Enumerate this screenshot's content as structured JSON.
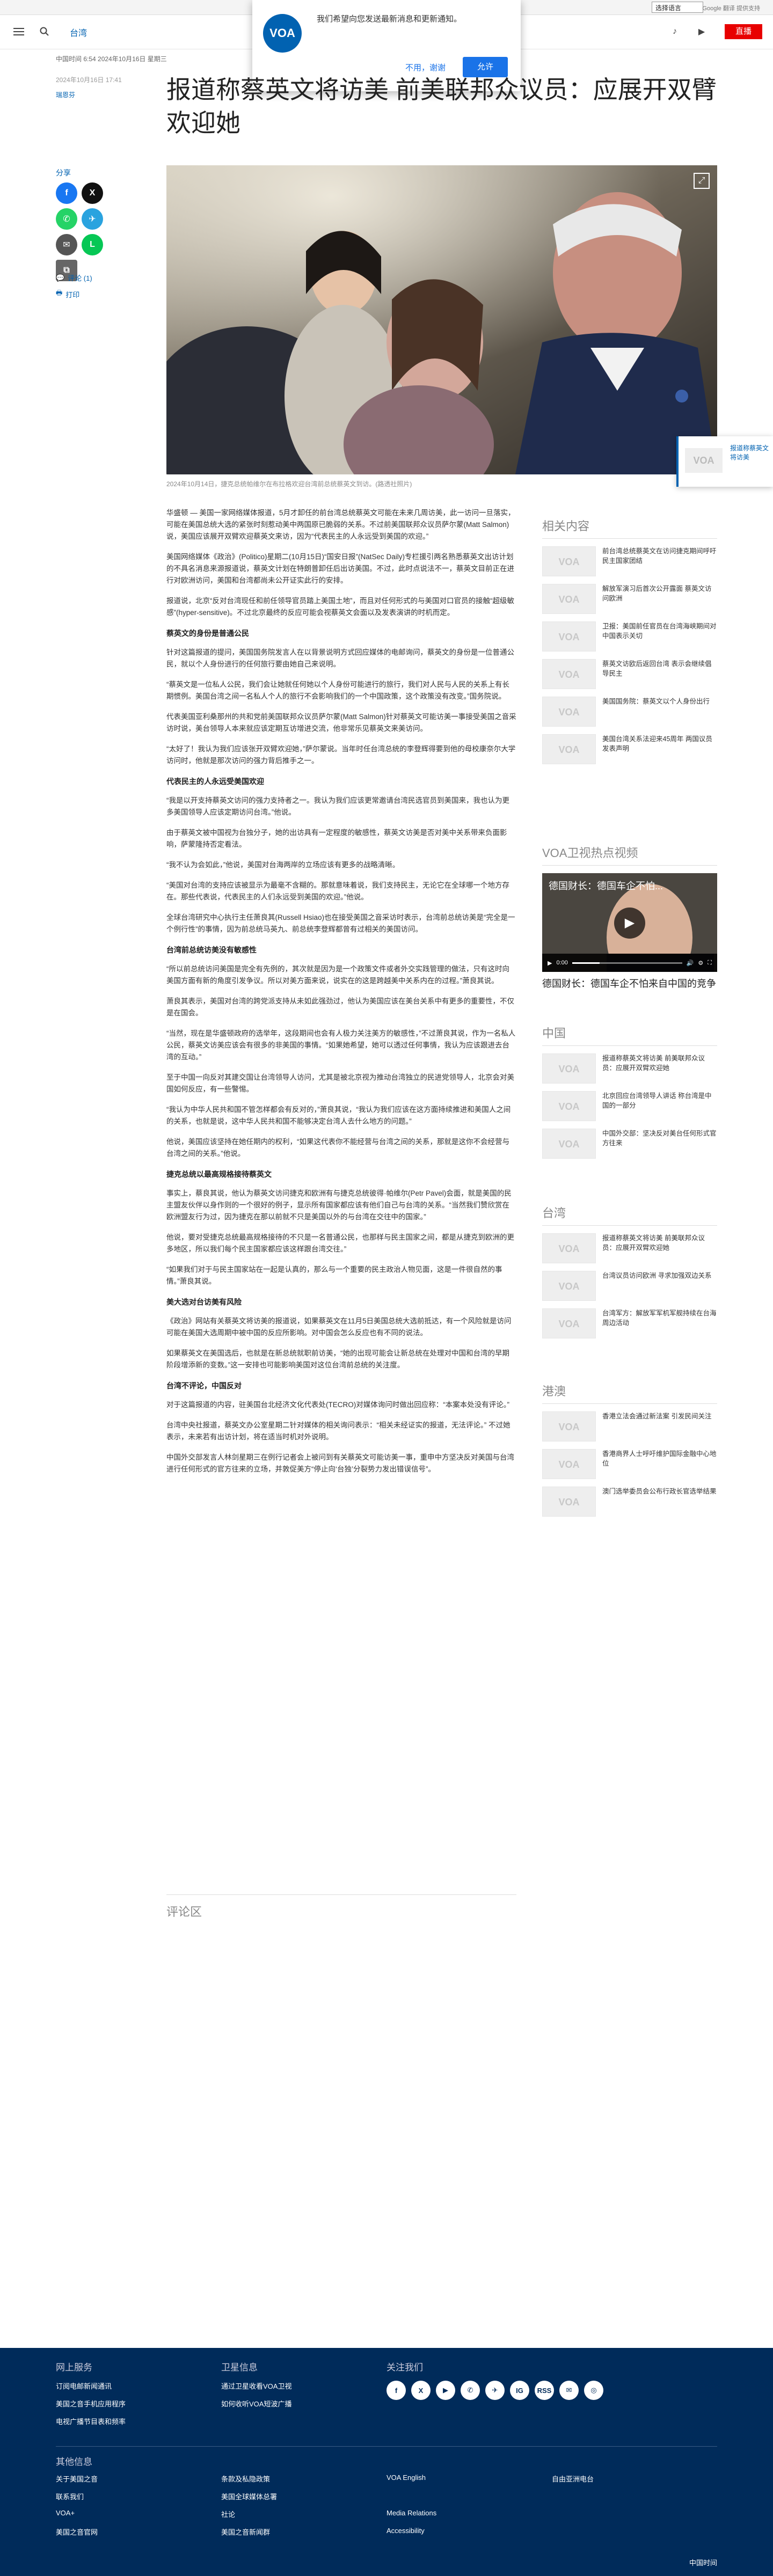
{
  "topbar": {
    "language_select": "选择语言",
    "translate_brand": "Google 翻译 提供支持"
  },
  "header": {
    "nav_link": "台湾",
    "live_label": "直播"
  },
  "popup": {
    "message": "我们希望向您发送最新消息和更新通知。",
    "logo_text": "VOA",
    "decline_label": "不用，谢谢",
    "accept_label": "允许"
  },
  "article": {
    "published": "中国时间 6:54 2024年10月16日 星期三",
    "updated": "2024年10月16日 17:41",
    "author": "瑞恩芬",
    "title": "报道称蔡英文将访美 前美联邦众议员：应展开双臂欢迎她",
    "share_label": "分享",
    "comments_link": "评论 (1)",
    "print_link": "打印",
    "image_caption": "2024年10月14日，捷克总统帕维尔在布拉格欢迎台湾前总统蔡英文到访。(路透社照片)",
    "comments_heading": "评论区"
  },
  "body": [
    {
      "type": "p",
      "text": "华盛顿 — 美国一家网络媒体报道，5月才卸任的前台湾总统蔡英文可能在未来几周访美，此一访问一旦落实，可能在美国总统大选的紧张时刻惹动美中两国原已脆弱的关系。不过前美国联邦众议员萨尔蒙(Matt Salmon)说，美国应该展开双臂欢迎蔡英文来访，因为“代表民主的人永远受到美国的欢迎。”"
    },
    {
      "type": "p",
      "text": "美国网络媒体《政治》(Politico)星期二(10月15日)“国安日报”(NatSec Daily)专栏援引两名熟悉蔡英文出访计划的不具名消息来源报道说，蔡英文计划在特朗普卸任后出访美国。不过，此时点说法不一，蔡英文目前正在进行对欧洲访问，美国和台湾都尚未公开证实此行的安排。"
    },
    {
      "type": "p",
      "text": "报道说，北京“反对台湾现任和前任领导官员踏上美国土地”，而且对任何形式的与美国对口官员的接触“超级敏感”(hyper-sensitive)。不过北京最终的反应可能会视蔡英文会面以及发表演讲的时机而定。"
    },
    {
      "type": "h",
      "text": "蔡英文的身份是普通公民"
    },
    {
      "type": "p",
      "text": "针对这篇报道的提问，美国国务院发言人在以背景说明方式回应媒体的电邮询问，蔡英文的身份是一位普通公民，就以个人身份进行的任何旅行要由她自己来说明。"
    },
    {
      "type": "p",
      "text": "“蔡英文是一位私人公民，我们会让她就任何她以个人身份可能进行的旅行，我们对人民与人民的关系上有长期惯例。美国台湾之间一名私人个人的旅行不会影响我们的一个中国政策，这个政策没有改变。”国务院说。"
    },
    {
      "type": "p",
      "text": "代表美国亚利桑那州的共和党前美国联邦众议员萨尔蒙(Matt Salmon)针对蔡英文可能访美一事接受美国之音采访时说，美台领导人本来就应该定期互访增进交流，他非常乐见蔡英文来美访问。"
    },
    {
      "type": "p",
      "text": "“太好了！我认为我们应该张开双臂欢迎她，”萨尔蒙说。当年时任台湾总统的李登辉得要到他的母校康奈尔大学访问时，他就是那次访问的强力背后推手之一。"
    },
    {
      "type": "h",
      "text": "代表民主的人永远受美国欢迎"
    },
    {
      "type": "p",
      "text": "“我是以开支持蔡英文访问的强力支持者之一。我认为我们应该更常邀请台湾民选官员到美国来，我也认为更多美国领导人应该定期访问台湾。”他说。"
    },
    {
      "type": "p",
      "text": "由于蔡英文被中国视为台独分子，她的出访具有一定程度的敏感性，蔡英文访美是否对美中关系带来负面影响，萨蒙隆持否定看法。"
    },
    {
      "type": "p",
      "text": "“我不认为会如此，”他说，美国对台海两岸的立场应该有更多的战略清晰。"
    },
    {
      "type": "p",
      "text": "“美国对台湾的支持应该被显示为最毫不含糊的。那就意味着说，我们支持民主，无论它在全球哪一个地方存在。那些代表说，代表民主的人们永远受到美国的欢迎。”他说。"
    },
    {
      "type": "p",
      "text": "全球台湾研究中心执行主任萧良其(Russell Hsiao)也在接受美国之音采访时表示，台湾前总统访美是“完全是一个例行性”的事情，因为前总统马英九、前总统李登辉都曾有过相关的美国访问。"
    },
    {
      "type": "h",
      "text": "台湾前总统访美没有敏感性"
    },
    {
      "type": "p",
      "text": "“所以前总统访问美国是完全有先例的，其次就是因为是一个政策文件或者外交实践管理的做法，只有这时向美国方面有新的角度引发争议。所以对美方面来说，说实在的这是跨越美中关系内在的过程。”萧良其说。"
    },
    {
      "type": "p",
      "text": "萧良其表示，美国对台湾的跨党派支持从未如此强劲过，他认为美国应该在美台关系中有更多的重要性，不仅是在国会。"
    },
    {
      "type": "p",
      "text": "“当然，现在是华盛顿政府的选举年，这段期间也会有人极力关注美方的敏感性，”不过萧良其说，作为一名私人公民，蔡英文访美应该会有很多的非美国的事情。“如果她希望，她可以透过任何事情，我认为应该跟进去台湾的互动。”"
    },
    {
      "type": "p",
      "text": "至于中国一向反对其建交国让台湾领导人访问，尤其是被北京视为推动台湾独立的民进党领导人，北京会对美国如何反应，有一些警惕。"
    },
    {
      "type": "p",
      "text": "“我认为中华人民共和国不管怎样都会有反对的，”萧良其说，“我认为我们应该在这方面持续推进和美国人之间的关系，也就是说，这中华人民共和国不能够决定台湾人去什么地方的问题。”"
    },
    {
      "type": "p",
      "text": "他说，美国应该坚持在她任期内的权利，“如果这代表你不能经营与台湾之间的关系，那就是这你不会经营与台湾之间的关系。”他说。"
    },
    {
      "type": "h",
      "text": "捷克总统以最高规格接待蔡英文"
    },
    {
      "type": "p",
      "text": "事实上，蔡良其说，他认为蔡英文访问捷克和欧洲有与捷克总统彼得·帕维尔(Petr Pavel)会面，就是美国的民主盟友伙伴以身作则的一个很好的例子，显示所有国家都应该有他们自己与台湾的关系。“当然我们赞欣赏在欧洲盟友行为过，因为捷克在那以前就不只是美国以外的与台湾在交往中的国家。”"
    },
    {
      "type": "p",
      "text": "他说，要对受捷克总统最高规格接待的不只是一名普通公民，也那样与民主国家之间，都是从捷克到欧洲的更多地区，所以我们每个民主国家都应该这样跟台湾交往。”"
    },
    {
      "type": "p",
      "text": "“如果我们对于与民主国家站在一起是认真的，那么与一个重要的民主政治人物见面，这是一件很自然的事情。”萧良其说。"
    },
    {
      "type": "h",
      "text": "美大选对台访美有风险"
    },
    {
      "type": "p",
      "text": "《政治》网站有关蔡英文将访美的报道说，如果蔡英文在11月5日美国总统大选前抵达，有一个风险就是访问可能在美国大选周期中被中国的反应所影响。对中国会怎么反应也有不同的说法。"
    },
    {
      "type": "p",
      "text": "如果蔡英文在美国选后，也就是在新总统就职前访美，“她的出现可能会让新总统在处理对中国和台湾的早期阶段增添新的变数。”这一安排也可能影响美国对这位台湾前总统的关注度。"
    },
    {
      "type": "h",
      "text": "台湾不评论，中国反对"
    },
    {
      "type": "p",
      "text": "对于这篇报道的内容，驻美国台北经济文化代表处(TECRO)对媒体询问时做出回应称：“本案本处没有评论。”"
    },
    {
      "type": "p",
      "text": "台湾中央社报道，蔡英文办公室星期二针对媒体的相关询问表示：“相关未经证实的报道，无法评论。” 不过她表示，未来若有出访计划，将在适当时机对外说明。"
    },
    {
      "type": "p",
      "text": "中国外交部发言人林剑星期三在例行记者会上被问到有关蔡英文可能访美一事，重申中方坚决反对美国与台湾进行任何形式的官方往来的立场，并敦促美方“停止向‘台独’分裂势力发出错误信号”。"
    }
  ],
  "rail": {
    "related_heading": "相关内容",
    "related": [
      "前台湾总统蔡英文在访问捷克期间呼吁民主国家团结",
      "解放军演习后首次公开露面 蔡英文访问欧洲",
      "卫报：美国前任官员在台湾海峡期间对中国表示关切",
      "蔡英文访欧后返回台湾 表示会继续倡导民主",
      "美国国务院：蔡英文以个人身份出行",
      "美国台湾关系法迎来45周年 两国议员发表声明"
    ],
    "video_heading": "VOA卫视热点视频",
    "video_title": "德国财长：德国车企不怕...",
    "video_time": "0:00",
    "video_caption": "德国财长：德国车企不怕来自中国的竞争",
    "china_heading": "中国",
    "china": [
      "报道称蔡英文将访美 前美联邦众议员：应展开双臂欢迎她",
      "北京回应台湾领导人讲话 称台湾是中国的一部分",
      "中国外交部：坚决反对美台任何形式官方往来"
    ],
    "taiwan_heading": "台湾",
    "taiwan": [
      "报道称蔡英文将访美 前美联邦众议员：应展开双臂欢迎她",
      "台湾议员访问欧洲 寻求加强双边关系",
      "台湾军方：解放军军机军舰持续在台海周边活动"
    ],
    "hk_heading": "港澳",
    "hk": [
      "香港立法会通过新法案 引发民间关注",
      "香港商界人士呼吁维护国际金融中心地位",
      "澳门选举委员会公布行政长官选举结果"
    ]
  },
  "float_tag": {
    "text": "报道称蔡英文将访美"
  },
  "footer": {
    "col1_heading": "网上服务",
    "col1": [
      "订阅电邮新闻通讯",
      "美国之音手机应用程序",
      "电视广播节目表和频率"
    ],
    "col2_heading": "卫星信息",
    "col2": [
      "通过卫星收看VOA卫视",
      "如何收听VOA短波广播"
    ],
    "col3_heading": "关注我们",
    "social": [
      "f",
      "X",
      "▶",
      "✆",
      "✈",
      "IG",
      "RSS",
      "✉",
      "◎"
    ],
    "other_heading": "其他信息",
    "links": [
      "关于美国之音",
      "条款及私隐政策",
      "VOA English",
      "自由亚洲电台",
      "联系我们",
      "美国全球媒体总署",
      "",
      "",
      "VOA+",
      "社论",
      "Media Relations",
      "",
      "美国之音官网",
      "美国之音新闻群",
      "Accessibility",
      ""
    ],
    "lang_label": "中国时间"
  }
}
